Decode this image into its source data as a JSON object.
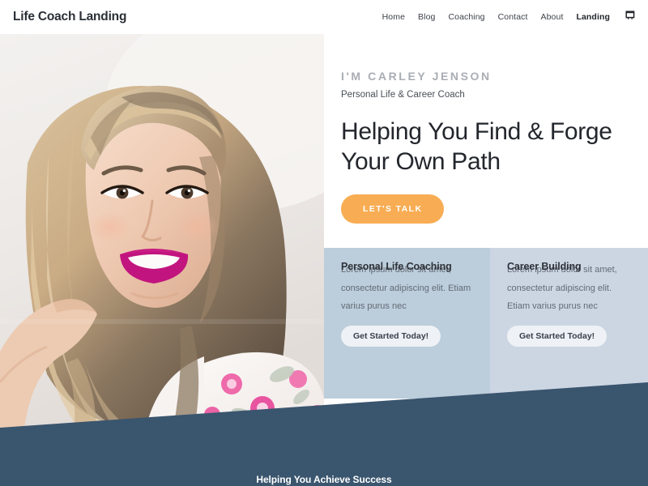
{
  "header": {
    "logo": "Life Coach Landing",
    "nav": [
      {
        "label": "Home",
        "active": false
      },
      {
        "label": "Blog",
        "active": false
      },
      {
        "label": "Coaching",
        "active": false
      },
      {
        "label": "Contact",
        "active": false
      },
      {
        "label": "About",
        "active": false
      },
      {
        "label": "Landing",
        "active": true
      }
    ],
    "cart_icon": "shopping-cart-icon"
  },
  "hero": {
    "eyebrow": "I'M CARLEY JENSON",
    "subtitle": "Personal Life & Career Coach",
    "heading": "Helping You Find & Forge Your Own Path",
    "cta_label": "LET'S TALK",
    "photo_alt": "portrait-of-smiling-woman-with-blonde-hair"
  },
  "cards": [
    {
      "title": "Personal Life Coaching",
      "body": "Lorem ipsum dolor sit amet, consectetur adipiscing elit. Etiam varius purus nec",
      "button_label": "Get Started Today!"
    },
    {
      "title": "Career Building",
      "body": "Lorem ipsum dolor sit amet, consectetur adipiscing elit. Etiam varius purus nec",
      "button_label": "Get Started Today!"
    }
  ],
  "band": {
    "title": "Helping You Achieve Success"
  },
  "colors": {
    "accent_orange": "#f8ad54",
    "navy": "#3a556e",
    "card_left": "#bccddb",
    "card_right": "#ccd6e3",
    "eyebrow_gray": "#a9aeb4",
    "text_dark": "#23262c"
  }
}
